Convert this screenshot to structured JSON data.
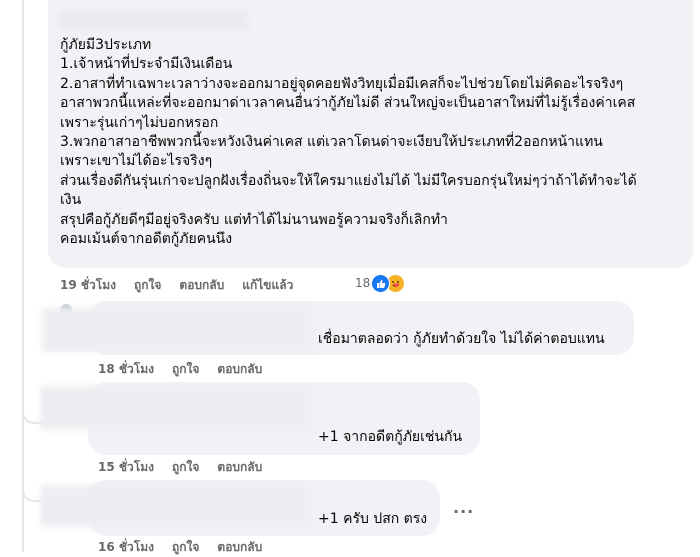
{
  "main_comment": {
    "lines": [
      "กู้ภัยมี3ประเภท",
      "1.เจ้าหน้าที่ประจำมีเงินเดือน",
      "2.อาสาที่ทำเฉพาะเวลาว่างจะออกมาอยู่จุดคอยฟังวิทยุเมื่อมีเคสก็จะไปช่วยโดยไม่คิดอะไรจริงๆ",
      "อาสาพวกนี้แหล่ะที่จะออกมาด่าเวลาคนอื่นว่ากู้ภัยไม่ดี ส่วนใหญ่จะเป็นอาสาใหม่ที่ไม่รู้เรื่องค่าเคส",
      "เพราะรุ่นเก่าๆไม่บอกหรอก",
      "3.พวกอาสาอาชีพพวกนี้จะหวังเงินค่าเคส แต่เวลาโดนด่าจะเงียบให้ประเภทที่2ออกหน้าแทน",
      "เพราะเขาไม่ได้อะไรจริงๆ",
      "ส่วนเรื่องดีกันรุ่นเก่าจะปลูกฝังเรื่องถิ่นจะให้ใครมาแย่งไม่ได้ ไม่มีใครบอกรุ่นใหม่ๆว่าถ้าได้ทำจะได้",
      "เงิน",
      "สรุปคือกู้ภัยดีๆมีอยู่จริงครับ แต่ทำได้ไม่นานพอรู้ความจริงก็เลิกทำ",
      "คอมเม้นต์จากอดีตกู้ภัยคนนึง"
    ],
    "time": "19 ชั่วโมง",
    "like": "ถูกใจ",
    "reply": "ตอบกลับ",
    "edited": "แก้ไขแล้ว",
    "reaction_count": "18"
  },
  "replies": [
    {
      "text": "เชื่อมาตลอดว่า กู้ภัยทำด้วยใจ ไม่ได้ค่าตอบแทน",
      "time": "18 ชั่วโมง",
      "like": "ถูกใจ",
      "reply": "ตอบกลับ"
    },
    {
      "text": "+1 จากอดีตกู้ภัยเช่นกัน",
      "time": "15 ชั่วโมง",
      "like": "ถูกใจ",
      "reply": "ตอบกลับ"
    },
    {
      "text": "+1 ครับ ปสก ตรง",
      "time": "16 ชั่วโมง",
      "like": "ถูกใจ",
      "reply": "ตอบกลับ",
      "more": "..."
    }
  ],
  "colors": {
    "bubble": "#f0f2f5",
    "meta": "#65676b",
    "like_blue": "#1877f2",
    "care_yellow": "#f7b125"
  },
  "icons": {
    "like": "thumbs-up-icon",
    "care": "care-emoji-icon",
    "more": "more-dots-icon"
  }
}
